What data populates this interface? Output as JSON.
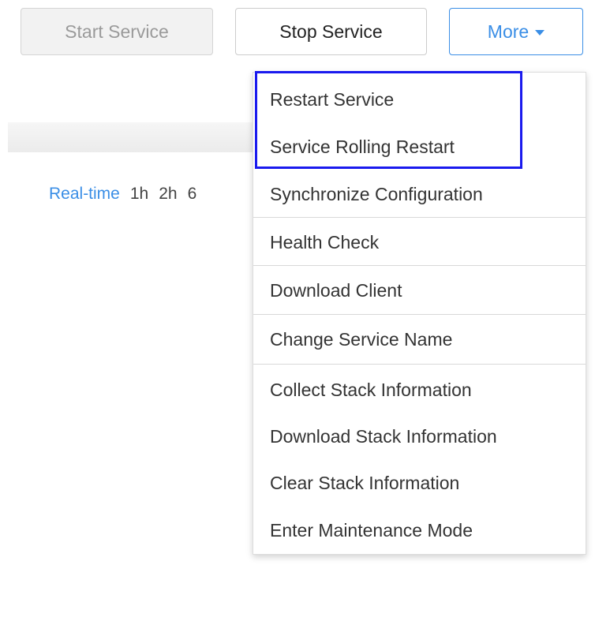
{
  "toolbar": {
    "start_label": "Start Service",
    "stop_label": "Stop Service",
    "more_label": "More",
    "more_icon": "caret-down-icon",
    "accent_color": "#3a8ee6"
  },
  "time_range": {
    "options": [
      "Real-time",
      "1h",
      "2h",
      "6"
    ],
    "active": "Real-time"
  },
  "more_menu": {
    "items": [
      {
        "label": "Restart Service"
      },
      {
        "label": "Service Rolling Restart"
      },
      {
        "label": "Synchronize Configuration"
      },
      {
        "label": "Health Check"
      },
      {
        "label": "Download Client"
      },
      {
        "label": "Change Service Name"
      },
      {
        "label": "Collect Stack Information"
      },
      {
        "label": "Download Stack Information"
      },
      {
        "label": "Clear Stack Information"
      },
      {
        "label": "Enter Maintenance Mode"
      }
    ],
    "highlighted_items": [
      "Restart Service",
      "Service Rolling Restart"
    ],
    "highlight_color": "#1a1aee"
  }
}
